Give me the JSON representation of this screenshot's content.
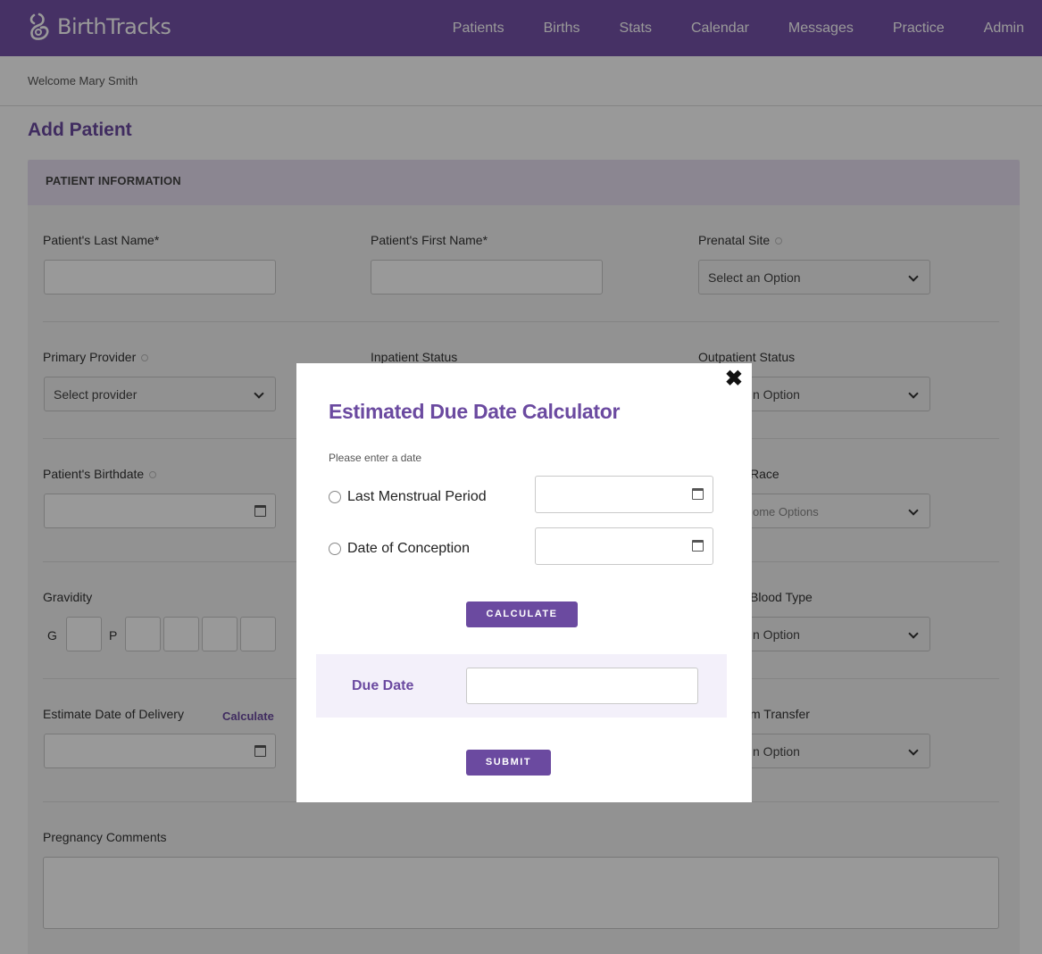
{
  "app": {
    "brand": "BirthTracks"
  },
  "nav": [
    "Patients",
    "Births",
    "Stats",
    "Calendar",
    "Messages",
    "Practice",
    "Admin"
  ],
  "welcome": "Welcome Mary Smith",
  "page_title": "Add Patient",
  "section_title": "PATIENT INFORMATION",
  "fields": {
    "last_name": "Patient's Last Name*",
    "first_name": "Patient's First Name*",
    "prenatal_site": "Prenatal Site",
    "prenatal_site_value": "Select an Option",
    "primary_provider": "Primary Provider",
    "primary_provider_value": "Select provider",
    "inpatient_status": "Inpatient Status",
    "outpatient_status": "Outpatient Status",
    "outpatient_status_value": "n Option",
    "birthdate": "Patient's Birthdate",
    "race": "Race",
    "race_value": "ome Options",
    "gravidity": "Gravidity",
    "g_letter": "G",
    "p_letter": "P",
    "blood_type": "Blood Type",
    "blood_type_value": "n Option",
    "edd": "Estimate Date of Delivery",
    "edd_calc_link": "Calculate",
    "transfer": "m Transfer",
    "transfer_value": "n Option",
    "comments": "Pregnancy Comments"
  },
  "modal": {
    "title": "Estimated Due Date Calculator",
    "hint": "Please enter a date",
    "option_lmp": "Last Menstrual Period",
    "option_conception": "Date of Conception",
    "calculate": "CALCULATE",
    "due_date_label": "Due Date",
    "submit": "SUBMIT",
    "close": "✖"
  },
  "colors": {
    "brand": "#7652a8",
    "accent": "#6b4aa0"
  }
}
